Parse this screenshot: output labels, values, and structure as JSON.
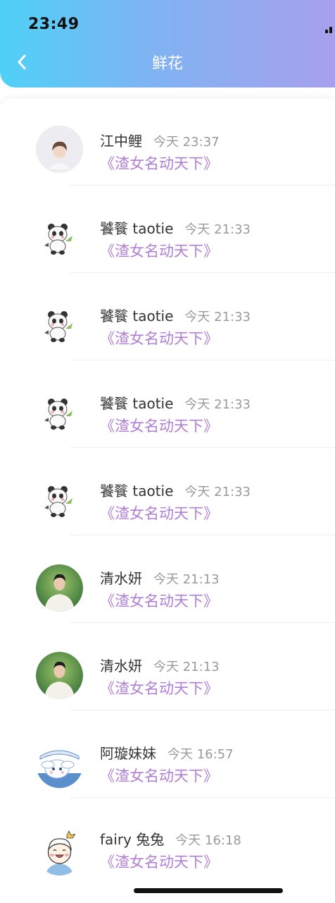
{
  "status_bar": {
    "time": "23:49"
  },
  "header": {
    "title": "鲜花"
  },
  "rows": [
    {
      "name": "江中鲤",
      "time": "今天 23:37",
      "book": "《渣女名动天下》",
      "avatar": "boy-avatar"
    },
    {
      "name": "饕餮 taotie",
      "time": "今天 21:33",
      "book": "《渣女名动天下》",
      "avatar": "panda-avatar"
    },
    {
      "name": "饕餮 taotie",
      "time": "今天 21:33",
      "book": "《渣女名动天下》",
      "avatar": "panda-avatar"
    },
    {
      "name": "饕餮 taotie",
      "time": "今天 21:33",
      "book": "《渣女名动天下》",
      "avatar": "panda-avatar"
    },
    {
      "name": "饕餮 taotie",
      "time": "今天 21:33",
      "book": "《渣女名动天下》",
      "avatar": "panda-avatar"
    },
    {
      "name": "清水妍",
      "time": "今天 21:13",
      "book": "《渣女名动天下》",
      "avatar": "photo-avatar"
    },
    {
      "name": "清水妍",
      "time": "今天 21:13",
      "book": "《渣女名动天下》",
      "avatar": "photo-avatar"
    },
    {
      "name": "阿璇妹妹",
      "time": "今天 16:57",
      "book": "《渣女名动天下》",
      "avatar": "cinnamoroll-avatar"
    },
    {
      "name": "fairy 兔兔",
      "time": "今天 16:18",
      "book": "《渣女名动天下》",
      "avatar": "cartoon-boy-avatar"
    }
  ],
  "colors": {
    "header_gradient_start": "#4fd1f7",
    "header_gradient_end": "#a8a0ec",
    "book_title": "#b17fd6",
    "name": "#333333",
    "time": "#9a9a9a"
  }
}
